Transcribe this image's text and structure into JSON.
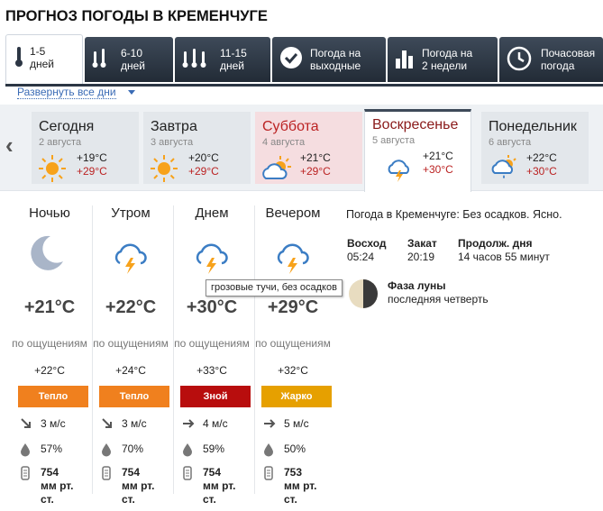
{
  "page_title": "ПРОГНОЗ ПОГОДЫ В КРЕМЕНЧУГЕ",
  "tabs": [
    {
      "line1": "1-5",
      "line2": "дней",
      "icon": "thermometer-icon"
    },
    {
      "line1": "6-10",
      "line2": "дней",
      "icon": "thermometers-icon"
    },
    {
      "line1": "11-15",
      "line2": "дней",
      "icon": "thermometers-icon"
    },
    {
      "line1": "Погода на",
      "line2": "выходные",
      "icon": "checkmark-icon"
    },
    {
      "line1": "Погода на",
      "line2": "2 недели",
      "icon": "bar-chart-icon"
    },
    {
      "line1": "Почасовая",
      "line2": "погода",
      "icon": "clock-icon"
    }
  ],
  "expand_all": "Развернуть все дни",
  "days": [
    {
      "name": "Сегодня",
      "date": "2 августа",
      "min": "+19°C",
      "max": "+29°C",
      "icon": "sun-icon"
    },
    {
      "name": "Завтра",
      "date": "3 августа",
      "min": "+20°C",
      "max": "+29°C",
      "icon": "sun-icon"
    },
    {
      "name": "Суббота",
      "date": "4 августа",
      "min": "+21°C",
      "max": "+29°C",
      "icon": "sun-cloud-icon"
    },
    {
      "name": "Воскресенье",
      "date": "5 августа",
      "min": "+21°C",
      "max": "+30°C",
      "icon": "thunderstorm-icon"
    },
    {
      "name": "Понедельник",
      "date": "6 августа",
      "min": "+22°C",
      "max": "+30°C",
      "icon": "rain-cloud-icon"
    }
  ],
  "periods": [
    {
      "name": "Ночью",
      "temp": "+21°C",
      "feels_label": "по ощущениям",
      "feels": "+22°C",
      "badge": "Тепло",
      "badge_color": "#f0801e",
      "wind": "3 м/с",
      "humidity": "57%",
      "pressure": "754 мм рт. ст.",
      "icon": "moon-icon"
    },
    {
      "name": "Утром",
      "temp": "+22°C",
      "feels_label": "по ощущениям",
      "feels": "+24°C",
      "badge": "Тепло",
      "badge_color": "#f0801e",
      "wind": "3 м/с",
      "humidity": "70%",
      "pressure": "754 мм рт. ст.",
      "icon": "thunderstorm-icon"
    },
    {
      "name": "Днем",
      "temp": "+30°C",
      "feels_label": "по ощущениям",
      "feels": "+33°C",
      "badge": "Зной",
      "badge_color": "#b80d0d",
      "wind": "4 м/с",
      "humidity": "59%",
      "pressure": "754 мм рт. ст.",
      "icon": "thunderstorm-icon"
    },
    {
      "name": "Вечером",
      "temp": "+29°C",
      "feels_label": "по ощущениям",
      "feels": "+32°C",
      "badge": "Жарко",
      "badge_color": "#e6a000",
      "wind": "5 м/с",
      "humidity": "50%",
      "pressure": "753 мм рт. ст.",
      "icon": "thunderstorm-icon"
    }
  ],
  "tooltip": "грозовые тучи, без осадков",
  "info": {
    "summary": "Погода в Кременчуге: Без осадков. Ясно.",
    "sunrise_label": "Восход",
    "sunrise": "05:24",
    "sunset_label": "Закат",
    "sunset": "20:19",
    "daylength_label": "Продолж. дня",
    "daylength": "14 часов 55 минут",
    "moon_label": "Фаза луны",
    "moon": "последняя четверть"
  }
}
